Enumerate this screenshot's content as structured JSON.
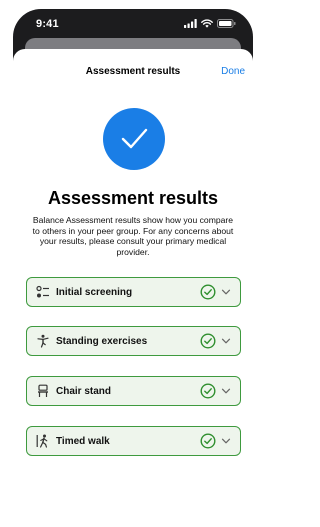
{
  "status_bar": {
    "time": "9:41",
    "icons": [
      "signal-icon",
      "wifi-icon",
      "battery-icon"
    ]
  },
  "nav": {
    "title": "Assessment results",
    "done_label": "Done"
  },
  "hero": {
    "icon": "checkmark-icon",
    "heading": "Assessment results",
    "description": "Balance Assessment results show how you compare to others in your peer group. For any concerns about your results, please consult your primary medical provider."
  },
  "sections": [
    {
      "label": "Initial screening",
      "icon": "checklist-icon",
      "status": "complete"
    },
    {
      "label": "Standing exercises",
      "icon": "standing-figure-icon",
      "status": "complete"
    },
    {
      "label": "Chair stand",
      "icon": "chair-icon",
      "status": "complete"
    },
    {
      "label": "Timed walk",
      "icon": "walking-figure-icon",
      "status": "complete"
    }
  ],
  "colors": {
    "accent": "#1a7ee6",
    "success": "#3e9a3e",
    "card_background": "#eef5ec"
  }
}
